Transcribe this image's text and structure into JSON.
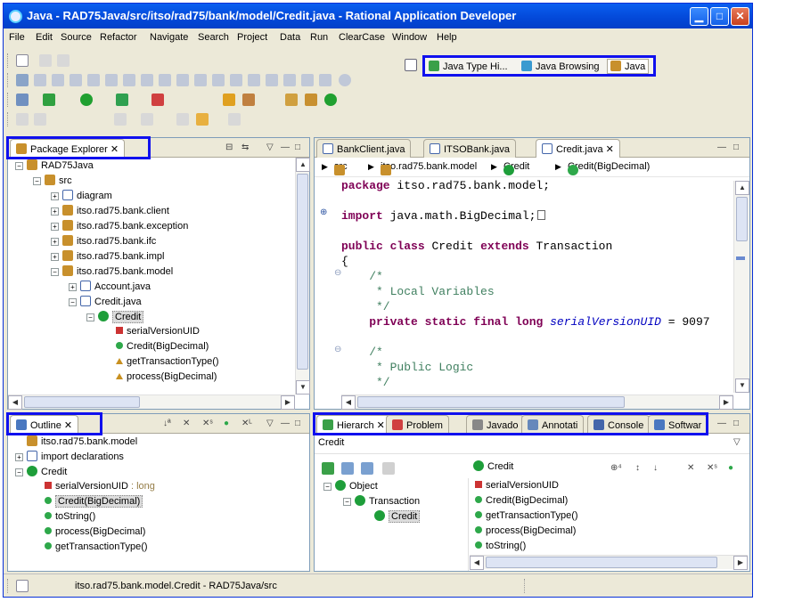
{
  "window": {
    "title": "Java - RAD75Java/src/itso/rad75/bank/model/Credit.java - Rational Application Developer"
  },
  "menu": [
    "File",
    "Edit",
    "Source",
    "Refactor",
    "Navigate",
    "Search",
    "Project",
    "Data",
    "Run",
    "ClearCase",
    "Window",
    "Help"
  ],
  "perspectives": [
    {
      "label": "Java Type Hi...",
      "active": false
    },
    {
      "label": "Java Browsing",
      "active": false
    },
    {
      "label": "Java",
      "active": true
    }
  ],
  "package_explorer": {
    "tab": "Package Explorer",
    "items": [
      {
        "label": "RAD75Java",
        "indent": 0,
        "exp": "−",
        "icon": "project"
      },
      {
        "label": "src",
        "indent": 1,
        "exp": "−",
        "icon": "pkg"
      },
      {
        "label": "diagram",
        "indent": 2,
        "exp": "+",
        "icon": "folder"
      },
      {
        "label": "itso.rad75.bank.client",
        "indent": 2,
        "exp": "+",
        "icon": "pkg"
      },
      {
        "label": "itso.rad75.bank.exception",
        "indent": 2,
        "exp": "+",
        "icon": "pkg"
      },
      {
        "label": "itso.rad75.bank.ifc",
        "indent": 2,
        "exp": "+",
        "icon": "pkg"
      },
      {
        "label": "itso.rad75.bank.impl",
        "indent": 2,
        "exp": "+",
        "icon": "pkg"
      },
      {
        "label": "itso.rad75.bank.model",
        "indent": 2,
        "exp": "−",
        "icon": "pkg"
      },
      {
        "label": "Account.java",
        "indent": 3,
        "exp": "+",
        "icon": "file"
      },
      {
        "label": "Credit.java",
        "indent": 3,
        "exp": "−",
        "icon": "file"
      },
      {
        "label": "Credit",
        "indent": 4,
        "exp": "−",
        "icon": "cls",
        "selected": true
      },
      {
        "label": "serialVersionUID",
        "indent": 5,
        "exp": "",
        "icon": "fld"
      },
      {
        "label": "Credit(BigDecimal)",
        "indent": 5,
        "exp": "",
        "icon": "dot"
      },
      {
        "label": "getTransactionType()",
        "indent": 5,
        "exp": "",
        "icon": "tri"
      },
      {
        "label": "process(BigDecimal)",
        "indent": 5,
        "exp": "",
        "icon": "tri"
      }
    ]
  },
  "editor": {
    "tabs": [
      {
        "label": "BankClient.java",
        "active": false
      },
      {
        "label": "ITSOBank.java",
        "active": false
      },
      {
        "label": "Credit.java",
        "active": true
      }
    ],
    "breadcrumb": [
      "src",
      "itso.rad75.bank.model",
      "Credit",
      "Credit(BigDecimal)"
    ],
    "code_lines": [
      {
        "kind": "package",
        "text": "package itso.rad75.bank.model;"
      },
      {
        "kind": "blank",
        "text": ""
      },
      {
        "kind": "import",
        "text": "import java.math.BigDecimal;"
      },
      {
        "kind": "blank",
        "text": ""
      },
      {
        "kind": "classdecl",
        "text": "public class Credit extends Transaction"
      },
      {
        "kind": "plain",
        "text": "{"
      },
      {
        "kind": "comment",
        "text": "    /*"
      },
      {
        "kind": "comment",
        "text": "     * Local Variables"
      },
      {
        "kind": "comment",
        "text": "     */"
      },
      {
        "kind": "field",
        "text": "    private static final long serialVersionUID = 9097"
      },
      {
        "kind": "blank",
        "text": ""
      },
      {
        "kind": "comment",
        "text": "    /*"
      },
      {
        "kind": "comment",
        "text": "     * Public Logic"
      },
      {
        "kind": "comment",
        "text": "     */"
      }
    ]
  },
  "outline": {
    "tab": "Outline",
    "items": [
      {
        "label": "itso.rad75.bank.model",
        "indent": 0,
        "exp": "",
        "icon": "pkg"
      },
      {
        "label": "import declarations",
        "indent": 0,
        "exp": "+",
        "icon": "import"
      },
      {
        "label": "Credit",
        "indent": 0,
        "exp": "−",
        "icon": "cls"
      },
      {
        "label": "serialVersionUID",
        "suffix": " : long",
        "indent": 1,
        "exp": "",
        "icon": "fld"
      },
      {
        "label": "Credit(BigDecimal)",
        "indent": 1,
        "exp": "",
        "icon": "dot",
        "selected": true
      },
      {
        "label": "toString()",
        "indent": 1,
        "exp": "",
        "icon": "dot"
      },
      {
        "label": "process(BigDecimal)",
        "indent": 1,
        "exp": "",
        "icon": "dot"
      },
      {
        "label": "getTransactionType()",
        "indent": 1,
        "exp": "",
        "icon": "dot"
      }
    ]
  },
  "bottom_views": {
    "tabs": [
      {
        "label": "Hierarch",
        "active": true
      },
      {
        "label": "Problem",
        "active": false
      },
      {
        "label": "Javado",
        "active": false
      },
      {
        "label": "Annotati",
        "active": false
      },
      {
        "label": "Console",
        "active": false
      },
      {
        "label": "Softwar",
        "active": false
      }
    ],
    "subject": "Credit",
    "member_header": "Credit",
    "hierarchy": [
      {
        "label": "Object",
        "indent": 0
      },
      {
        "label": "Transaction",
        "indent": 1
      },
      {
        "label": "Credit",
        "indent": 2,
        "selected": true
      }
    ],
    "members": [
      "serialVersionUID",
      "Credit(BigDecimal)",
      "getTransactionType()",
      "process(BigDecimal)",
      "toString()"
    ]
  },
  "status": {
    "text": "itso.rad75.bank.model.Credit - RAD75Java/src"
  }
}
